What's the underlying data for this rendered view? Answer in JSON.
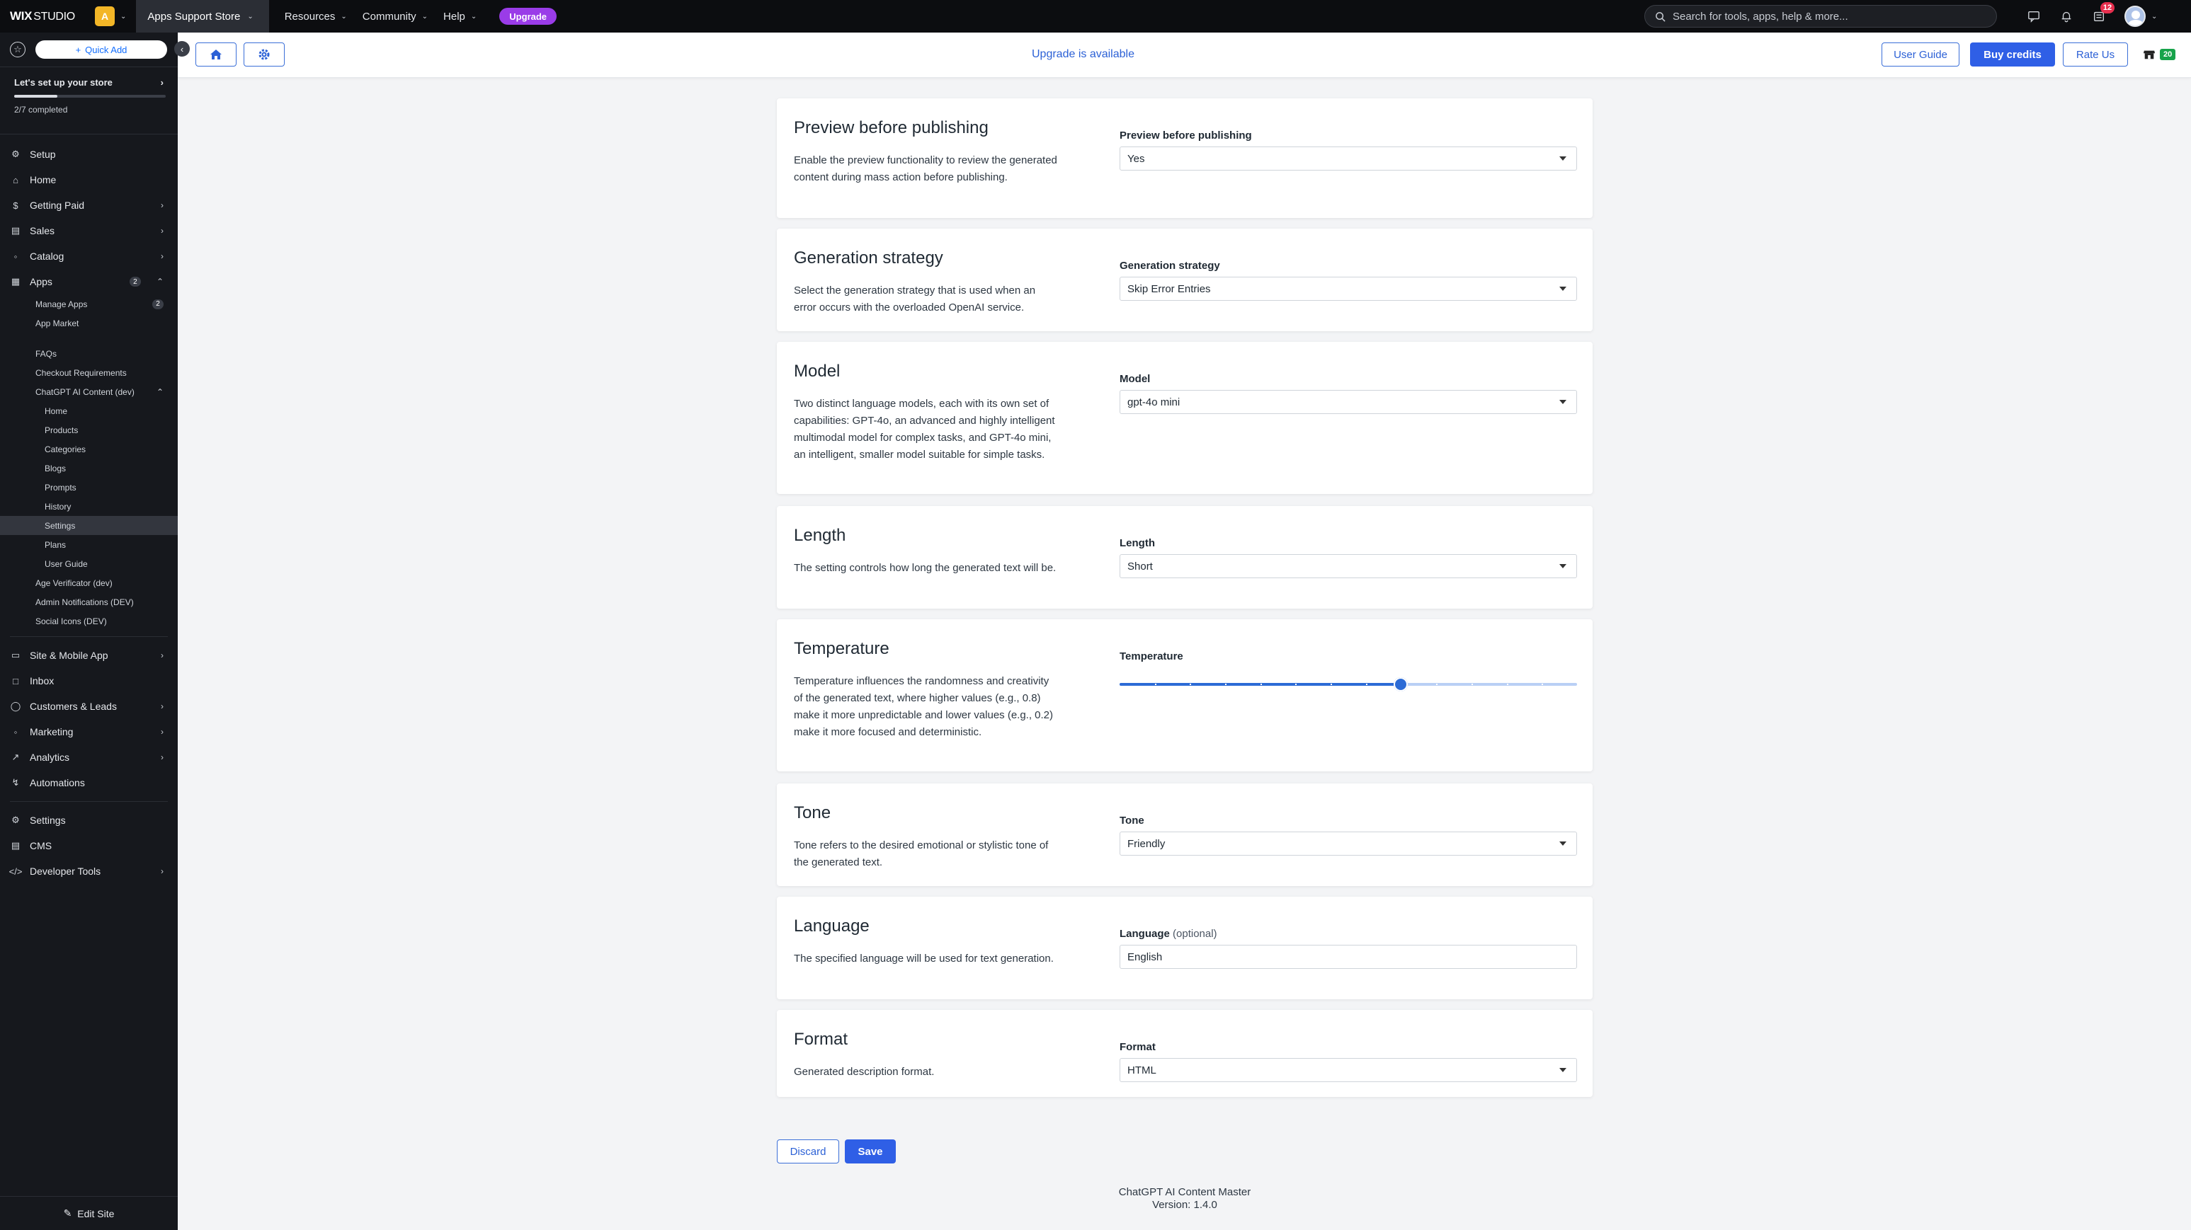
{
  "topbar": {
    "brand_bold": "WIX",
    "brand_rest": "STUDIO",
    "site_initial": "A",
    "site_name": "Apps Support Store",
    "menu": [
      {
        "label": "Resources"
      },
      {
        "label": "Community"
      },
      {
        "label": "Help"
      }
    ],
    "upgrade_label": "Upgrade",
    "search_placeholder": "Search for tools, apps, help & more...",
    "notifications_count": "12"
  },
  "sidebar": {
    "quick_add": "Quick Add",
    "setup_title": "Let's set up your store",
    "setup_progress": "2/7 completed",
    "setup_fraction": 0.2857,
    "items": [
      {
        "label": "Setup"
      },
      {
        "label": "Home"
      },
      {
        "label": "Getting Paid"
      },
      {
        "label": "Sales"
      },
      {
        "label": "Catalog"
      },
      {
        "label": "Apps",
        "count": "2"
      }
    ],
    "apps_sub": [
      {
        "label": "Manage Apps",
        "count": "2"
      },
      {
        "label": "App Market"
      }
    ],
    "apps_sub2": [
      {
        "label": "FAQs"
      },
      {
        "label": "Checkout Requirements"
      },
      {
        "label": "ChatGPT AI Content (dev)"
      }
    ],
    "chatgpt_sub": [
      {
        "label": "Home"
      },
      {
        "label": "Products"
      },
      {
        "label": "Categories"
      },
      {
        "label": "Blogs"
      },
      {
        "label": "Prompts"
      },
      {
        "label": "History"
      },
      {
        "label": "Settings"
      },
      {
        "label": "Plans"
      },
      {
        "label": "User Guide"
      }
    ],
    "apps_sub3": [
      {
        "label": "Age Verificator (dev)"
      },
      {
        "label": "Admin Notifications (DEV)"
      },
      {
        "label": "Social Icons (DEV)"
      }
    ],
    "items2": [
      {
        "label": "Site & Mobile App"
      },
      {
        "label": "Inbox"
      },
      {
        "label": "Customers & Leads"
      },
      {
        "label": "Marketing"
      },
      {
        "label": "Analytics"
      },
      {
        "label": "Automations"
      }
    ],
    "items3": [
      {
        "label": "Settings"
      },
      {
        "label": "CMS"
      },
      {
        "label": "Developer Tools"
      }
    ],
    "edit_site": "Edit Site"
  },
  "header": {
    "upgrade_text": "Upgrade is available",
    "user_guide": "User Guide",
    "buy_credits": "Buy credits",
    "rate_us": "Rate Us",
    "store_badge": "20"
  },
  "settings": [
    {
      "title": "Preview before publishing",
      "description": "Enable the preview functionality to review the generated content during mass action before publishing.",
      "label": "Preview before publishing",
      "value": "Yes"
    },
    {
      "title": "Generation strategy",
      "description": "Select the generation strategy that is used when an error occurs with the overloaded OpenAI service.",
      "label": "Generation strategy",
      "value": "Skip Error Entries"
    },
    {
      "title": "Model",
      "description": "Two distinct language models, each with its own set of capabilities: GPT-4o, an advanced and highly intelligent multimodal model for complex tasks, and GPT-4o mini, an intelligent, smaller model suitable for simple tasks.",
      "label": "Model",
      "value": "gpt-4o mini"
    },
    {
      "title": "Length",
      "description": "The setting controls how long the generated text will be.",
      "label": "Length",
      "value": "Short"
    },
    {
      "title": "Temperature",
      "description": "Temperature influences the randomness and creativity of the generated text, where higher values (e.g., 0.8) make it more unpredictable and lower values (e.g., 0.2) make it more focused and deterministic.",
      "label": "Temperature",
      "slider_fraction": 0.615
    },
    {
      "title": "Tone",
      "description": "Tone refers to the desired emotional or stylistic tone of the generated text.",
      "label": "Tone",
      "value": "Friendly"
    },
    {
      "title": "Language",
      "description": "The specified language will be used for text generation.",
      "label": "Language",
      "label_optional": "(optional)",
      "value": "English"
    },
    {
      "title": "Format",
      "description": "Generated description format.",
      "label": "Format",
      "value": "HTML"
    }
  ],
  "actions": {
    "discard": "Discard",
    "save": "Save"
  },
  "footer": {
    "app_name": "ChatGPT AI Content Master",
    "version": "Version: 1.4.0"
  }
}
